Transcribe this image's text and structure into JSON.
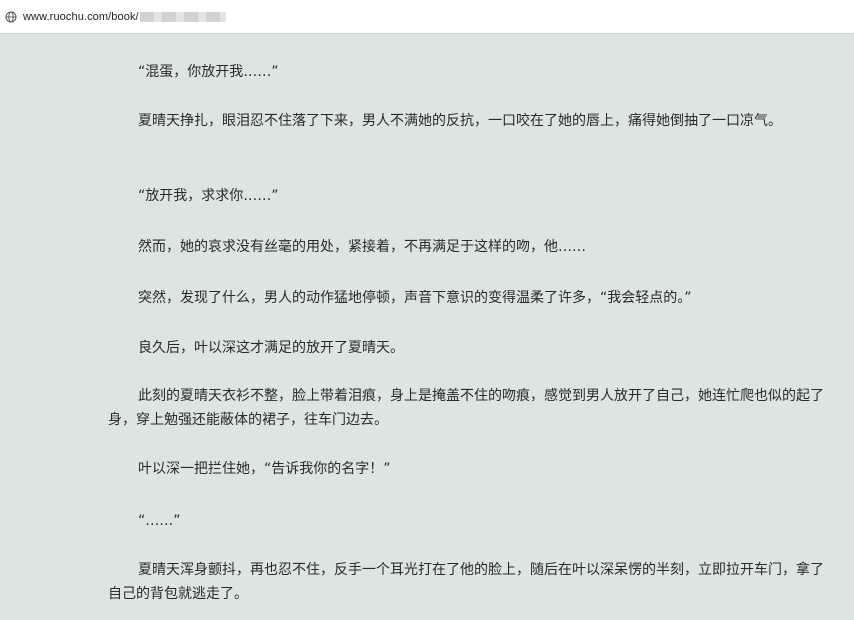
{
  "browser": {
    "url": "www.ruochu.com/book/"
  },
  "article": {
    "paragraphs": [
      "“混蛋，你放开我……”",
      "夏晴天挣扎，眼泪忍不住落了下来，男人不满她的反抗，一口咬在了她的唇上，痛得她倒抽了一口凉气。",
      "“放开我，求求你……”",
      "然而，她的哀求没有丝毫的用处，紧接着，不再满足于这样的吻，他……",
      "突然，发现了什么，男人的动作猛地停顿，声音下意识的变得温柔了许多，“我会轻点的。”",
      "良久后，叶以深这才满足的放开了夏晴天。",
      "此刻的夏晴天衣衫不整，脸上带着泪痕，身上是掩盖不住的吻痕，感觉到男人放开了自己，她连忙爬也似的起了身，穿上勉强还能蔽体的裙子，往车门边去。",
      "叶以深一把拦住她，“告诉我你的名字！”",
      "“……”",
      "夏晴天浑身颤抖，再也忍不住，反手一个耳光打在了他的脸上，随后在叶以深呆愣的半刻，立即拉开车门，拿了自己的背包就逃走了。"
    ]
  },
  "colors": {
    "reader_background": "#dce5e3",
    "text": "#2a2a2a"
  }
}
